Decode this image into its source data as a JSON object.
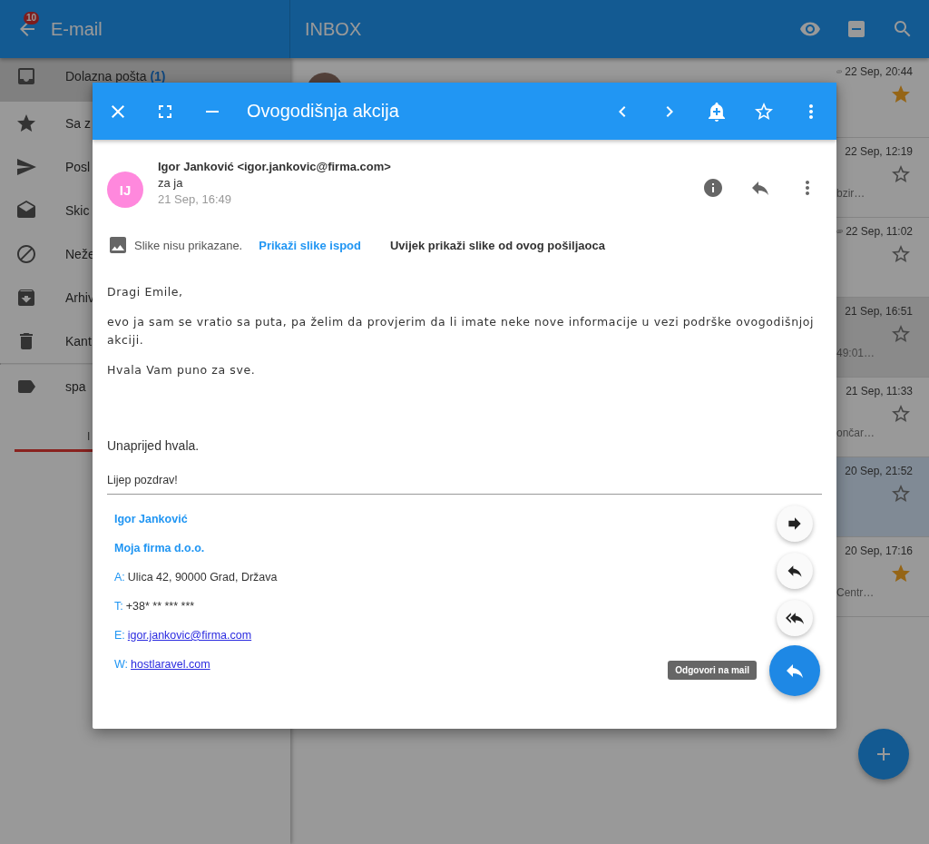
{
  "app_bar": {
    "title": "E-mail",
    "badge": "10"
  },
  "sidebar": {
    "items": [
      {
        "kind": "inbox",
        "label": "Dolazna pošta",
        "count": "(1)",
        "selected": true
      },
      {
        "kind": "star",
        "label": "Sa z",
        "selected": false
      },
      {
        "kind": "send",
        "label": "Posl",
        "selected": false
      },
      {
        "kind": "drafts",
        "label": "Skic",
        "selected": false
      },
      {
        "kind": "block",
        "label": "Neže",
        "selected": false
      },
      {
        "kind": "archive",
        "label": "Arhiv",
        "selected": false
      },
      {
        "kind": "trash",
        "label": "Kant",
        "selected": false
      }
    ],
    "labels": [
      {
        "label": "spa"
      }
    ],
    "storage_label": "I"
  },
  "inbox": {
    "title": "INBOX",
    "rows": [
      {
        "date": "22 Sep, 20:44",
        "avatar": true,
        "attachment": true,
        "starred": true,
        "selected": false,
        "hovered": false
      },
      {
        "date": "22 Sep, 12:19",
        "snippet": "bzir…",
        "avatar": false,
        "attachment": false,
        "starred": false,
        "selected": false,
        "hovered": false
      },
      {
        "date": "22 Sep, 11:02",
        "avatar": false,
        "attachment": true,
        "starred": false,
        "selected": false,
        "hovered": false
      },
      {
        "date": "21 Sep, 16:51",
        "snippet": "49:01…",
        "avatar": false,
        "attachment": false,
        "starred": false,
        "selected": false,
        "hovered": true
      },
      {
        "date": "21 Sep, 11:33",
        "snippet": "ončar…",
        "avatar": false,
        "attachment": false,
        "starred": false,
        "selected": false,
        "hovered": false
      },
      {
        "date": "20 Sep, 21:52",
        "avatar": false,
        "attachment": false,
        "starred": false,
        "selected": true,
        "hovered": false
      },
      {
        "date": "20 Sep, 17:16",
        "snippet": "Centr…",
        "avatar": false,
        "attachment": false,
        "starred": true,
        "selected": false,
        "hovered": false
      }
    ]
  },
  "message": {
    "subject": "Ovogodišnja akcija",
    "sender": "Igor Janković <igor.jankovic@firma.com>",
    "initials": "IJ",
    "to": "za ja",
    "date": "21 Sep, 16:49",
    "images_notice": "Slike nisu prikazane.",
    "show_images": "Prikaži slike ispod",
    "always_show": "Uvijek prikaži slike od ovog pošiljaoca",
    "body": [
      "Dragi Emile,",
      "evo ja sam se vratio sa puta, pa želim da provjerim da li imate neke nove informacije u vezi podrške ovogodišnjoj akciji.",
      "Hvala Vam puno za sve."
    ],
    "closing": "Unaprijed hvala.",
    "greeting": "Lijep pozdrav!",
    "signature": {
      "name": "Igor Janković",
      "company": "Moja firma d.o.o.",
      "lines": [
        {
          "label": "A:",
          "value": "Ulica 42, 90000 Grad, Država",
          "kind": "text"
        },
        {
          "label": "T:",
          "value": "+38* ** *** ***",
          "kind": "text"
        },
        {
          "label": "E:",
          "value": "igor.jankovic@firma.com",
          "kind": "link"
        },
        {
          "label": "W:",
          "value": "hostlaravel.com",
          "kind": "link"
        }
      ]
    },
    "reply_tooltip": "Odgovori na mail"
  }
}
